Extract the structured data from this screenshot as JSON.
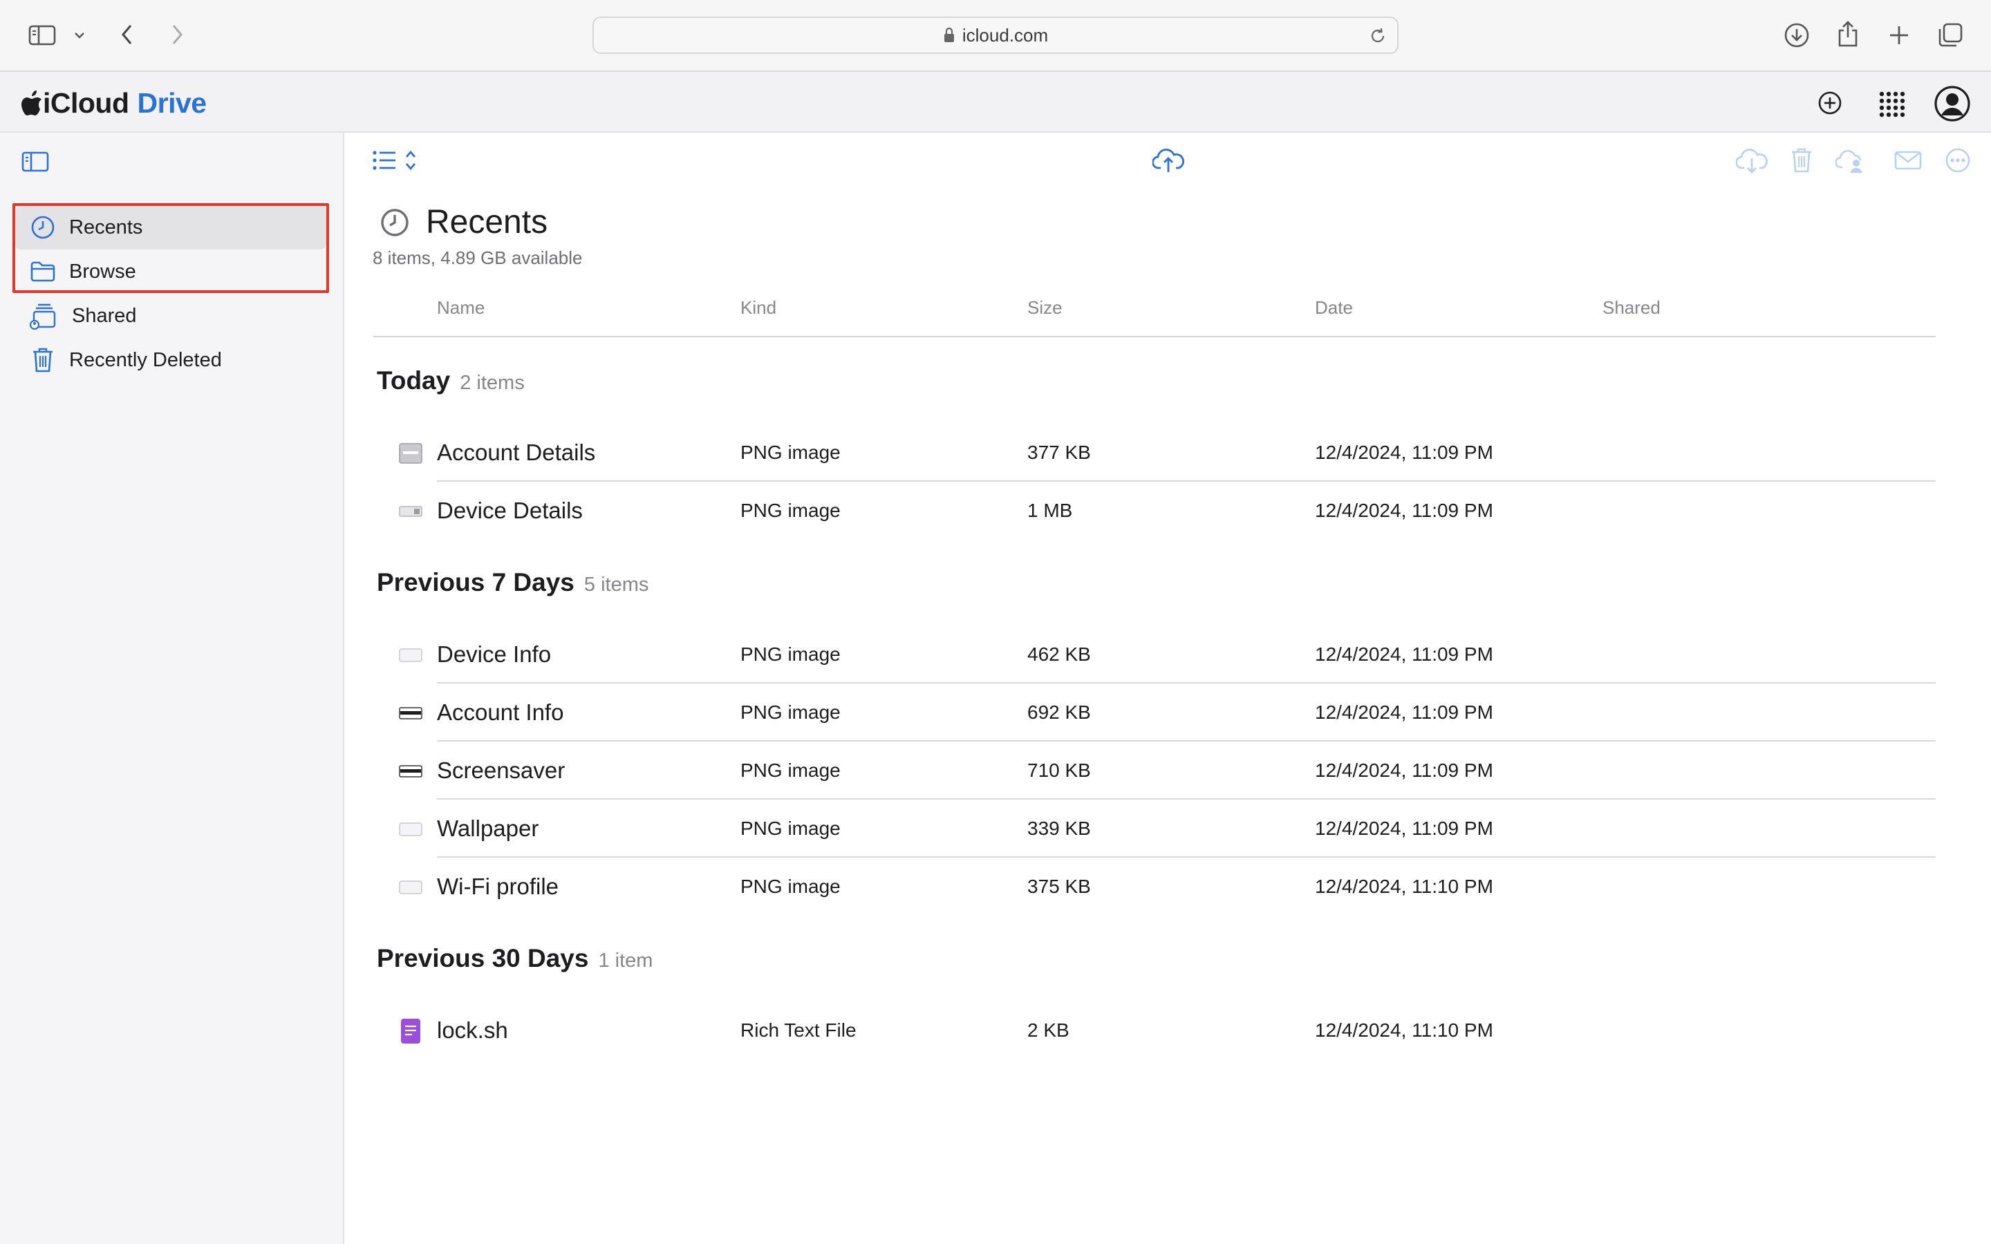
{
  "browser": {
    "url": "icloud.com"
  },
  "app": {
    "name_part1": "iCloud",
    "name_part2": "Drive"
  },
  "sidebar": {
    "items": [
      {
        "label": "Recents",
        "icon": "clock-icon",
        "selected": true
      },
      {
        "label": "Browse",
        "icon": "folder-icon",
        "selected": false
      },
      {
        "label": "Shared",
        "icon": "shared-folder-icon",
        "selected": false
      },
      {
        "label": "Recently Deleted",
        "icon": "trash-icon",
        "selected": false
      }
    ]
  },
  "main": {
    "title": "Recents",
    "subtitle": "8 items, 4.89 GB available",
    "columns": [
      "Name",
      "Kind",
      "Size",
      "Date",
      "Shared"
    ],
    "groups": [
      {
        "name": "Today",
        "count": "2 items",
        "rows": [
          {
            "name": "Account Details",
            "kind": "PNG image",
            "size": "377 KB",
            "date": "12/4/2024, 11:09 PM",
            "icon": "png-thumbnail-icon"
          },
          {
            "name": "Device Details",
            "kind": "PNG image",
            "size": "1 MB",
            "date": "12/4/2024, 11:09 PM",
            "icon": "png-thumbnail-icon"
          }
        ]
      },
      {
        "name": "Previous 7 Days",
        "count": "5 items",
        "rows": [
          {
            "name": "Device Info",
            "kind": "PNG image",
            "size": "462 KB",
            "date": "12/4/2024, 11:09 PM",
            "icon": "png-thumbnail-icon"
          },
          {
            "name": "Account Info",
            "kind": "PNG image",
            "size": "692 KB",
            "date": "12/4/2024, 11:09 PM",
            "icon": "png-thumbnail-icon"
          },
          {
            "name": "Screensaver",
            "kind": "PNG image",
            "size": "710 KB",
            "date": "12/4/2024, 11:09 PM",
            "icon": "png-thumbnail-icon"
          },
          {
            "name": "Wallpaper",
            "kind": "PNG image",
            "size": "339 KB",
            "date": "12/4/2024, 11:09 PM",
            "icon": "png-thumbnail-icon"
          },
          {
            "name": "Wi-Fi profile",
            "kind": "PNG image",
            "size": "375 KB",
            "date": "12/4/2024, 11:10 PM",
            "icon": "png-thumbnail-icon"
          }
        ]
      },
      {
        "name": "Previous 30 Days",
        "count": "1 item",
        "rows": [
          {
            "name": "lock.sh",
            "kind": "Rich Text File",
            "size": "2 KB",
            "date": "12/4/2024, 11:10 PM",
            "icon": "document-icon"
          }
        ]
      }
    ]
  },
  "colors": {
    "accent": "#2a72d5",
    "highlight_border": "#e0392b",
    "document_icon": "#9b4fd9"
  }
}
